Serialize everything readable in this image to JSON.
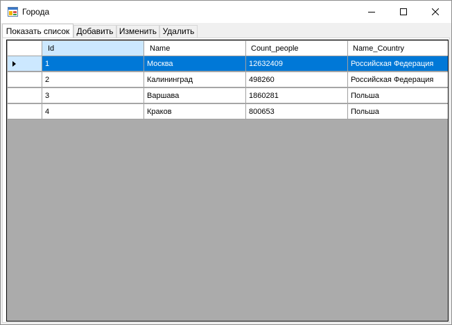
{
  "window": {
    "title": "Города",
    "icon": "forms-app-icon"
  },
  "caption_buttons": {
    "minimize": "minimize-icon",
    "maximize": "maximize-icon",
    "close": "close-icon"
  },
  "tabs": [
    {
      "label": "Показать список",
      "active": true
    },
    {
      "label": "Добавить",
      "active": false
    },
    {
      "label": "Изменить",
      "active": false
    },
    {
      "label": "Удалить",
      "active": false
    }
  ],
  "grid": {
    "columns": [
      "Id",
      "Name",
      "Count_people",
      "Name_Country"
    ],
    "rows": [
      [
        "1",
        "Москва",
        "12632409",
        "Российская Федерация"
      ],
      [
        "2",
        "Калининград",
        "498260",
        "Российская Федерация"
      ],
      [
        "3",
        "Варшава",
        "1860281",
        "Польша"
      ],
      [
        "4",
        "Краков",
        "800653",
        "Польша"
      ]
    ],
    "selected_row": 0
  },
  "colors": {
    "selection": "#0078d7",
    "header_selected": "#cce8ff",
    "grid_background": "#ababab"
  }
}
